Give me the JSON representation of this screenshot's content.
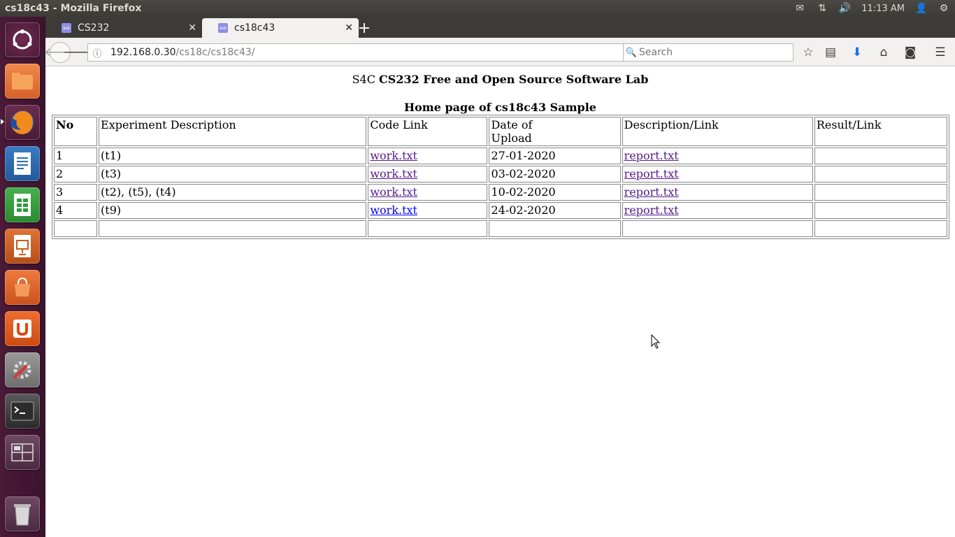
{
  "window": {
    "title": "cs18c43 - Mozilla Firefox"
  },
  "tray": {
    "clock": "11:13 AM"
  },
  "tabs": [
    {
      "label": "CS232",
      "active": false
    },
    {
      "label": "cs18c43",
      "active": true
    }
  ],
  "navbar": {
    "url_host": "192.168.0.30",
    "url_path": "/cs18c/cs18c43/",
    "search_placeholder": "Search"
  },
  "page": {
    "heading_prefix": "S4C",
    "heading_bold": "CS232 Free and Open Source Software Lab",
    "subheading": "Home page of cs18c43 Sample",
    "table": {
      "headers": [
        "No",
        "Experiment Description",
        "Code Link",
        "Date of Upload",
        "Description/Link",
        "Result/Link"
      ],
      "header_date_line1": "Date of",
      "header_date_line2": "Upload",
      "rows": [
        {
          "no": "1",
          "desc": "(t1)",
          "code": "work.txt",
          "date": "27-01-2020",
          "report": "report.txt",
          "result": ""
        },
        {
          "no": "2",
          "desc": "(t3)",
          "code": "work.txt",
          "date": "03-02-2020",
          "report": "report.txt",
          "result": ""
        },
        {
          "no": "3",
          "desc": "(t2), (t5), (t4)",
          "code": "work.txt",
          "date": "10-02-2020",
          "report": "report.txt",
          "result": ""
        },
        {
          "no": "4",
          "desc": "(t9)",
          "code": "work.txt",
          "date": "24-02-2020",
          "report": "report.txt",
          "result": ""
        },
        {
          "no": "",
          "desc": "",
          "code": "",
          "date": "",
          "report": "",
          "result": ""
        }
      ]
    }
  },
  "launcher": [
    {
      "name": "ubuntu-dash-icon",
      "color": "#dd4814"
    },
    {
      "name": "files-icon",
      "color": "#e8772e"
    },
    {
      "name": "firefox-icon",
      "color": "#e66000"
    },
    {
      "name": "writer-icon",
      "color": "#2a6bb3"
    },
    {
      "name": "calc-icon",
      "color": "#2e9b3c"
    },
    {
      "name": "impress-icon",
      "color": "#c85a1e"
    },
    {
      "name": "software-center-icon",
      "color": "#e0622a"
    },
    {
      "name": "ubuntu-one-icon",
      "color": "#e05a22"
    },
    {
      "name": "system-settings-icon",
      "color": "#8a8a8a"
    },
    {
      "name": "terminal-icon",
      "color": "#2c2c2c"
    },
    {
      "name": "workspace-switcher-icon",
      "color": "#5a3a50"
    },
    {
      "name": "trash-icon",
      "color": "#9a9a9a"
    }
  ]
}
